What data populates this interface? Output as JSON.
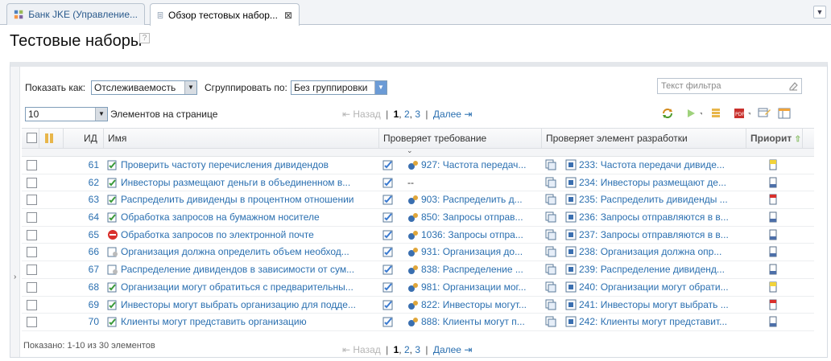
{
  "tabs": [
    {
      "label": "Банк JKE (Управление...",
      "active": false
    },
    {
      "label": "Обзор тестовых набор...",
      "active": true,
      "close": "⊠"
    }
  ],
  "page": {
    "title": "Тестовые наборы",
    "help": "?"
  },
  "controls": {
    "show_as_label": "Показать как:",
    "show_as_value": "Отслеживаемость",
    "group_by_label": "Сгруппировать по:",
    "group_by_value": "Без группировки",
    "filter_placeholder": "Текст фильтра",
    "page_size_value": "10",
    "page_size_label": "Элементов на странице"
  },
  "pager": {
    "prev": "Назад",
    "pages": [
      "1",
      "2",
      "3"
    ],
    "next": "Далее",
    "sep": "|"
  },
  "table": {
    "columns": {
      "id": "ИД",
      "name": "Имя",
      "requirement": "Проверяет требование",
      "dev_item": "Проверяет элемент разработки",
      "priority": "Приорит"
    },
    "rows": [
      {
        "id": "61",
        "name": "Проверить частоту перечисления дивидендов",
        "req": "927: Частота передач...",
        "dev": "233: Частота передачи дивиде...",
        "prio": "yellow"
      },
      {
        "id": "62",
        "name": "Инвесторы размещают деньги в объединенном в...",
        "req": "--",
        "dev": "234: Инвесторы размещают де...",
        "prio": "blue"
      },
      {
        "id": "63",
        "name": "Распределить дивиденды в процентном отношении",
        "req": "903: Распределить д...",
        "dev": "235: Распределить дивиденды ...",
        "prio": "red"
      },
      {
        "id": "64",
        "name": "Обработка запросов на бумажном носителе",
        "req": "850: Запросы отправ...",
        "dev": "236: Запросы отправляются в в...",
        "prio": "blue"
      },
      {
        "id": "65",
        "name": "Обработка запросов по электронной почте",
        "req": "1036: Запросы отпра...",
        "dev": "237: Запросы отправляются в в...",
        "prio": "blue"
      },
      {
        "id": "66",
        "name": "Организация должна определить объем необход...",
        "req": "931: Организация до...",
        "dev": "238: Организация должна опр...",
        "prio": "blue"
      },
      {
        "id": "67",
        "name": "Распределение дивидендов в зависимости от сум...",
        "req": "838: Распределение ...",
        "dev": "239: Распределение дивиденд...",
        "prio": "blue"
      },
      {
        "id": "68",
        "name": "Организации могут обратиться с предварительны...",
        "req": "981: Организации мог...",
        "dev": "240: Организации могут обрати...",
        "prio": "yellow"
      },
      {
        "id": "69",
        "name": "Инвесторы могут выбрать организацию для подде...",
        "req": "822: Инвесторы могут...",
        "dev": "241: Инвесторы могут выбрать ...",
        "prio": "red"
      },
      {
        "id": "70",
        "name": "Клиенты могут представить организацию",
        "req": "888: Клиенты могут п...",
        "dev": "242: Клиенты могут представит...",
        "prio": "blue"
      }
    ]
  },
  "footer": {
    "shown": "Показано: 1-10 из 30 элементов"
  },
  "colors": {
    "link": "#2a6fb0",
    "yellow": "#f2d33a",
    "red": "#d9302c",
    "blue": "#4d6fa8"
  }
}
